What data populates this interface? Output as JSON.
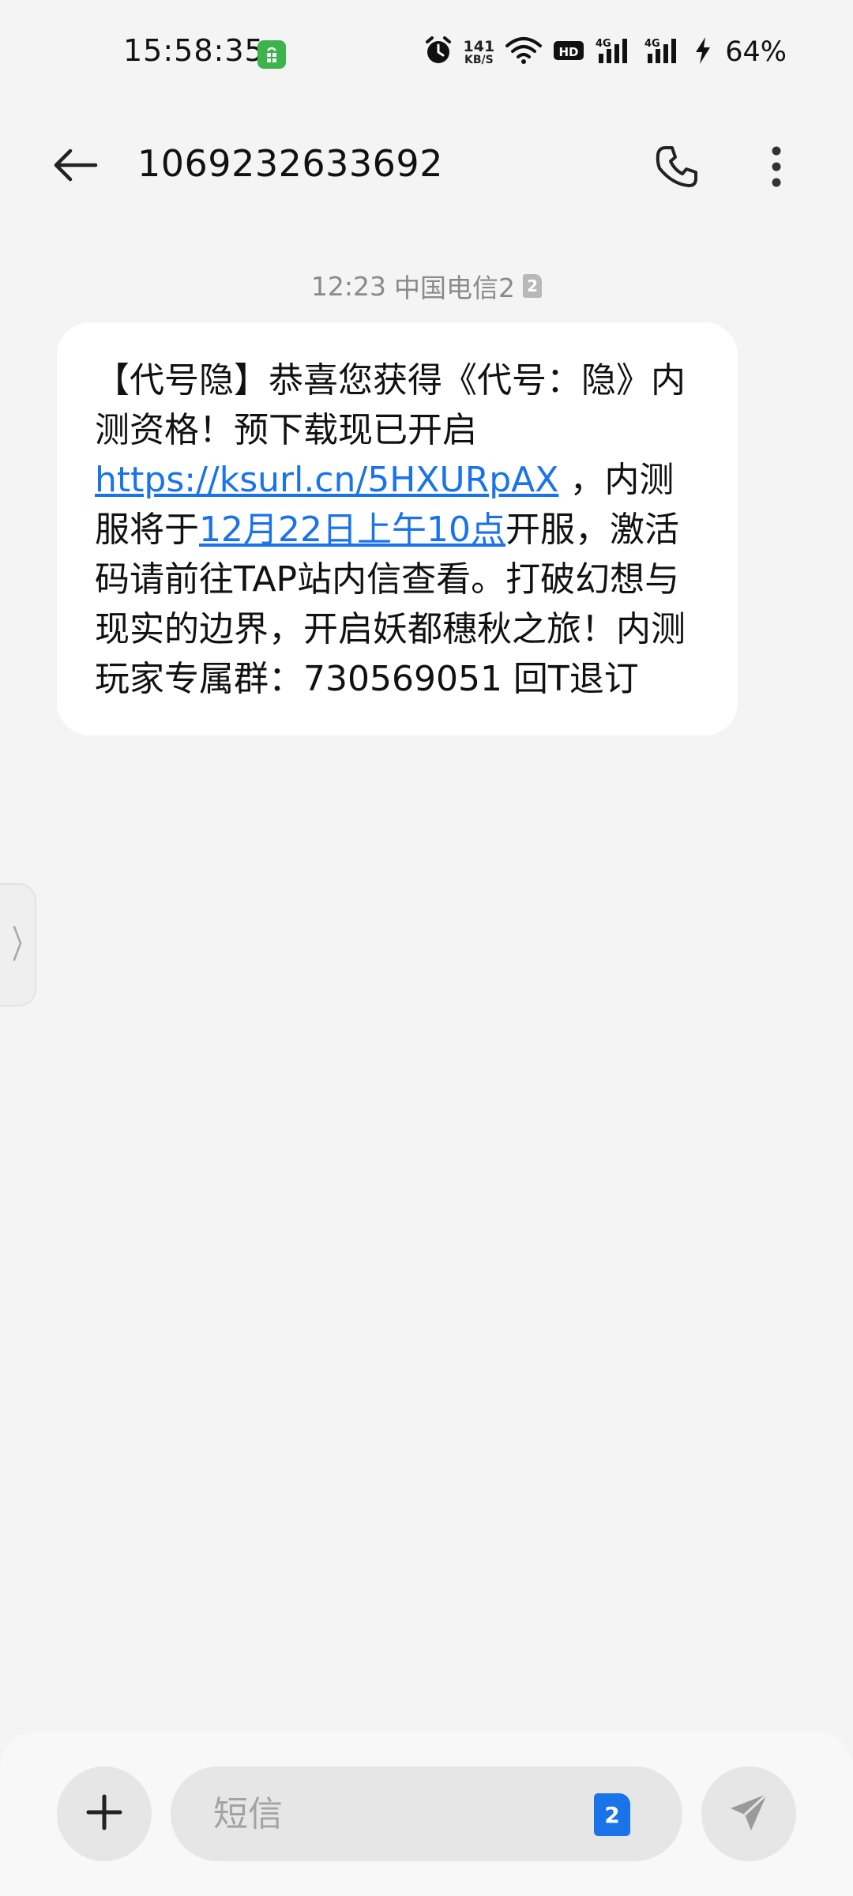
{
  "status_bar": {
    "time": "15:58:35",
    "net_speed_value": "141",
    "net_speed_unit": "KB/S",
    "hd_label": "HD",
    "signal_1_label": "4G",
    "signal_2_label": "4G",
    "battery_percent": "64%",
    "app_icon_color": "#3cb44b"
  },
  "header": {
    "title": "1069232633692",
    "back_icon": "back-arrow-icon",
    "call_icon": "phone-icon",
    "more_icon": "more-vertical-icon"
  },
  "conversation": {
    "timestamp": "12:23",
    "carrier": "中国电信2",
    "sim_badge": "2",
    "message": {
      "part1": "【代号隐】恭喜您获得《代号：隐》内测资格！预下载现已开启",
      "link": "https://ksurl.cn/5HXURpAX",
      "part2": " ，内测服将于",
      "date_link": "12月22日上午10点",
      "part3": "开服，激活码请前往TAP站内信查看。打破幻想与现实的边界，开启妖都穗秋之旅！内测玩家专属群：730569051 回T退订"
    }
  },
  "composer": {
    "placeholder": "短信",
    "sim_label": "2",
    "add_icon": "plus-icon",
    "send_icon": "send-icon"
  },
  "colors": {
    "link": "#1a73e8",
    "background": "#f4f4f4",
    "bubble": "#ffffff",
    "sim_badge_active": "#1a73e8"
  }
}
